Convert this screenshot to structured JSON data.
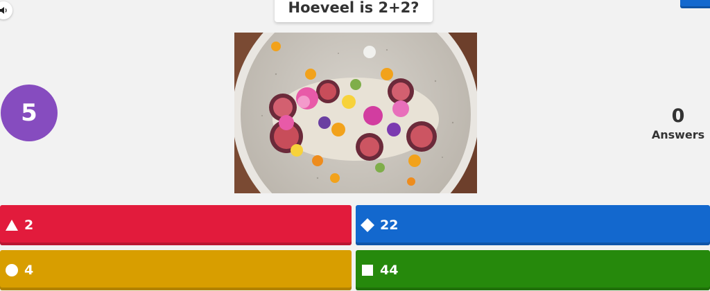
{
  "question": {
    "title": "Hoeveel is 2+2?"
  },
  "timer": {
    "value": "5"
  },
  "answers_count": {
    "number": "0",
    "label": "Answers"
  },
  "options": [
    {
      "shape": "triangle-icon",
      "text": "2",
      "color": "#e21b3c"
    },
    {
      "shape": "diamond-icon",
      "text": "22",
      "color": "#1368ce"
    },
    {
      "shape": "circle-icon",
      "text": "4",
      "color": "#d89e00"
    },
    {
      "shape": "square-icon",
      "text": "44",
      "color": "#26890c"
    }
  ],
  "colors": {
    "timer": "#864cbf",
    "background": "#f2f2f2"
  },
  "icons": {
    "sound": "speaker-icon",
    "media": "food-plate-image"
  }
}
